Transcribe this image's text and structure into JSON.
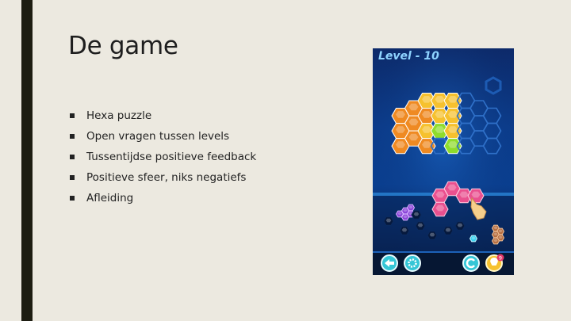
{
  "slide": {
    "title": "De game",
    "bullets": [
      "Hexa puzzle",
      "Open vragen tussen levels",
      "Tussentijdse positieve feedback",
      "Positieve sfeer, niks negatiefs",
      "Afleiding"
    ]
  },
  "game": {
    "level_label": "Level - 10",
    "hint_badge": "9",
    "colors": {
      "orange": "#ef8a22",
      "yellow": "#f6c12e",
      "green": "#8fdc2c",
      "pink": "#e9508f",
      "purple": "#8a43d8",
      "brown": "#b66c3e",
      "cyan": "#3ad2ef",
      "board_outline": "#2f70c8"
    },
    "icons": {
      "back": "back-icon",
      "settings": "settings-icon",
      "restart": "restart-icon",
      "hint": "lightbulb-icon",
      "hand": "pointing-hand-icon"
    }
  }
}
